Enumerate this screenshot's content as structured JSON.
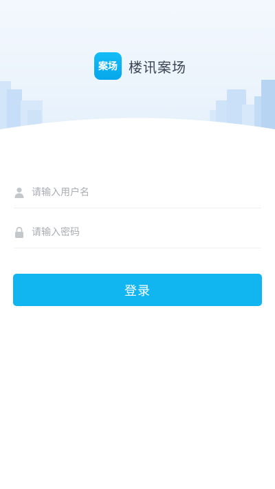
{
  "app": {
    "logo_text": "案场",
    "title": "楼讯案场"
  },
  "form": {
    "username_placeholder": "请输入用户名",
    "username_value": "",
    "password_placeholder": "请输入密码",
    "password_value": "",
    "login_label": "登录"
  },
  "icons": {
    "username": "user-icon",
    "password": "lock-icon"
  },
  "colors": {
    "accent": "#11b6f0",
    "logo_bg": "#0aaef0",
    "header_bg": "#eaf3fc",
    "title_text": "#3a4451",
    "placeholder": "#a9adb3"
  }
}
